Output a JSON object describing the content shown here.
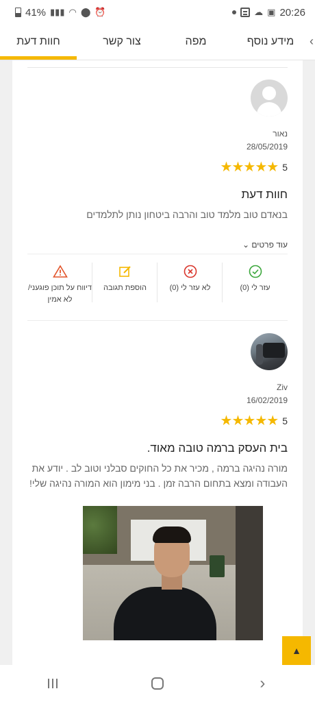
{
  "status_bar": {
    "battery": "41%",
    "time": "20:26"
  },
  "tabs": [
    {
      "label": "חוות דעת",
      "active": true
    },
    {
      "label": "צור קשר"
    },
    {
      "label": "מפה"
    },
    {
      "label": "מידע נוסף"
    }
  ],
  "reviews": [
    {
      "name": "נאור",
      "date": "28/05/2019",
      "rating": "5",
      "stars": "★★★★★",
      "title": "חוות דעת",
      "text": "בנאדם טוב מלמד טוב והרבה ביטחון נותן לתלמדים",
      "more": "עוד פרטים ⌄"
    },
    {
      "name": "Ziv",
      "date": "16/02/2019",
      "rating": "5",
      "stars": "★★★★★",
      "title": "בית העסק ברמה טובה מאוד.",
      "text": "מורה נהיגה ברמה , מכיר את כל החוקים סבלני וטוב לב . יודע את העבודה ומצא בתחום הרבה זמן . בני מימון הוא המורה נהיגה שלי!"
    }
  ],
  "actions": {
    "helpful": "עזר לי (0)",
    "not_helpful": "לא עזר לי (0)",
    "add_reply": "הוספת תגובה",
    "report_line1": "דיווח על תוכן פוגעני/",
    "report_line2": "לא אמין"
  },
  "colors": {
    "accent": "#f5b800",
    "helpful": "#3aa63a",
    "not_helpful": "#d9352b",
    "report": "#e2542a"
  }
}
